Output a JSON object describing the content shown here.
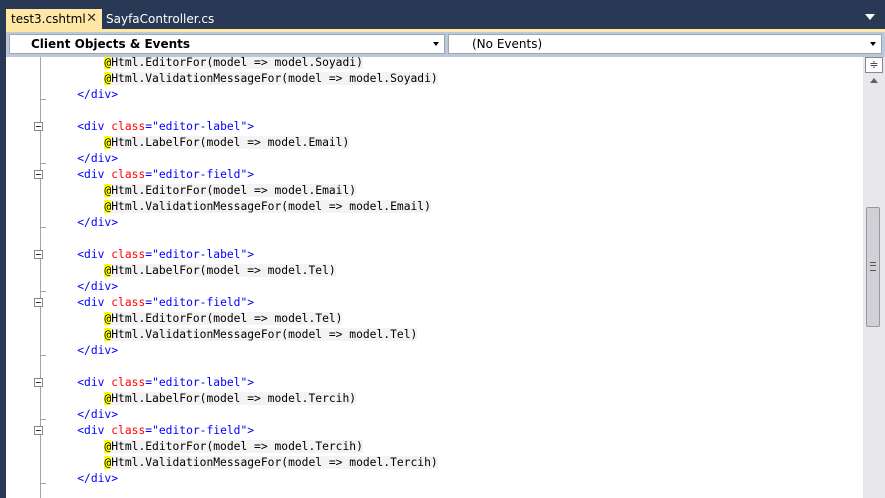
{
  "tabs": [
    {
      "label": "test3.cshtml",
      "active": true,
      "close": "✕"
    },
    {
      "label": "SayfaController.cs",
      "active": false
    }
  ],
  "navbar": {
    "objects": "Client Objects & Events",
    "events": "(No Events)"
  },
  "code": [
    {
      "indent": "        ",
      "text": "Html.EditorFor(model => model.Soyadi)",
      "kind": "razor"
    },
    {
      "indent": "        ",
      "text": "Html.ValidationMessageFor(model => model.Soyadi)",
      "kind": "razor"
    },
    {
      "indent": "    ",
      "text": "</div>",
      "kind": "close"
    },
    {
      "indent": "",
      "text": "",
      "kind": "blank"
    },
    {
      "indent": "    ",
      "cls": "editor-label",
      "kind": "open"
    },
    {
      "indent": "        ",
      "text": "Html.LabelFor(model => model.Email)",
      "kind": "razor"
    },
    {
      "indent": "    ",
      "text": "</div>",
      "kind": "close"
    },
    {
      "indent": "    ",
      "cls": "editor-field",
      "kind": "open"
    },
    {
      "indent": "        ",
      "text": "Html.EditorFor(model => model.Email)",
      "kind": "razor"
    },
    {
      "indent": "        ",
      "text": "Html.ValidationMessageFor(model => model.Email)",
      "kind": "razor"
    },
    {
      "indent": "    ",
      "text": "</div>",
      "kind": "close"
    },
    {
      "indent": "",
      "text": "",
      "kind": "blank"
    },
    {
      "indent": "    ",
      "cls": "editor-label",
      "kind": "open"
    },
    {
      "indent": "        ",
      "text": "Html.LabelFor(model => model.Tel)",
      "kind": "razor"
    },
    {
      "indent": "    ",
      "text": "</div>",
      "kind": "close"
    },
    {
      "indent": "    ",
      "cls": "editor-field",
      "kind": "open"
    },
    {
      "indent": "        ",
      "text": "Html.EditorFor(model => model.Tel)",
      "kind": "razor"
    },
    {
      "indent": "        ",
      "text": "Html.ValidationMessageFor(model => model.Tel)",
      "kind": "razor"
    },
    {
      "indent": "    ",
      "text": "</div>",
      "kind": "close"
    },
    {
      "indent": "",
      "text": "",
      "kind": "blank"
    },
    {
      "indent": "    ",
      "cls": "editor-label",
      "kind": "open"
    },
    {
      "indent": "        ",
      "text": "Html.LabelFor(model => model.Tercih)",
      "kind": "razor"
    },
    {
      "indent": "    ",
      "text": "</div>",
      "kind": "close"
    },
    {
      "indent": "    ",
      "cls": "editor-field",
      "kind": "open"
    },
    {
      "indent": "        ",
      "text": "Html.EditorFor(model => model.Tercih)",
      "kind": "razor"
    },
    {
      "indent": "        ",
      "text": "Html.ValidationMessageFor(model => model.Tercih)",
      "kind": "razor"
    },
    {
      "indent": "    ",
      "text": "</div>",
      "kind": "close"
    }
  ]
}
